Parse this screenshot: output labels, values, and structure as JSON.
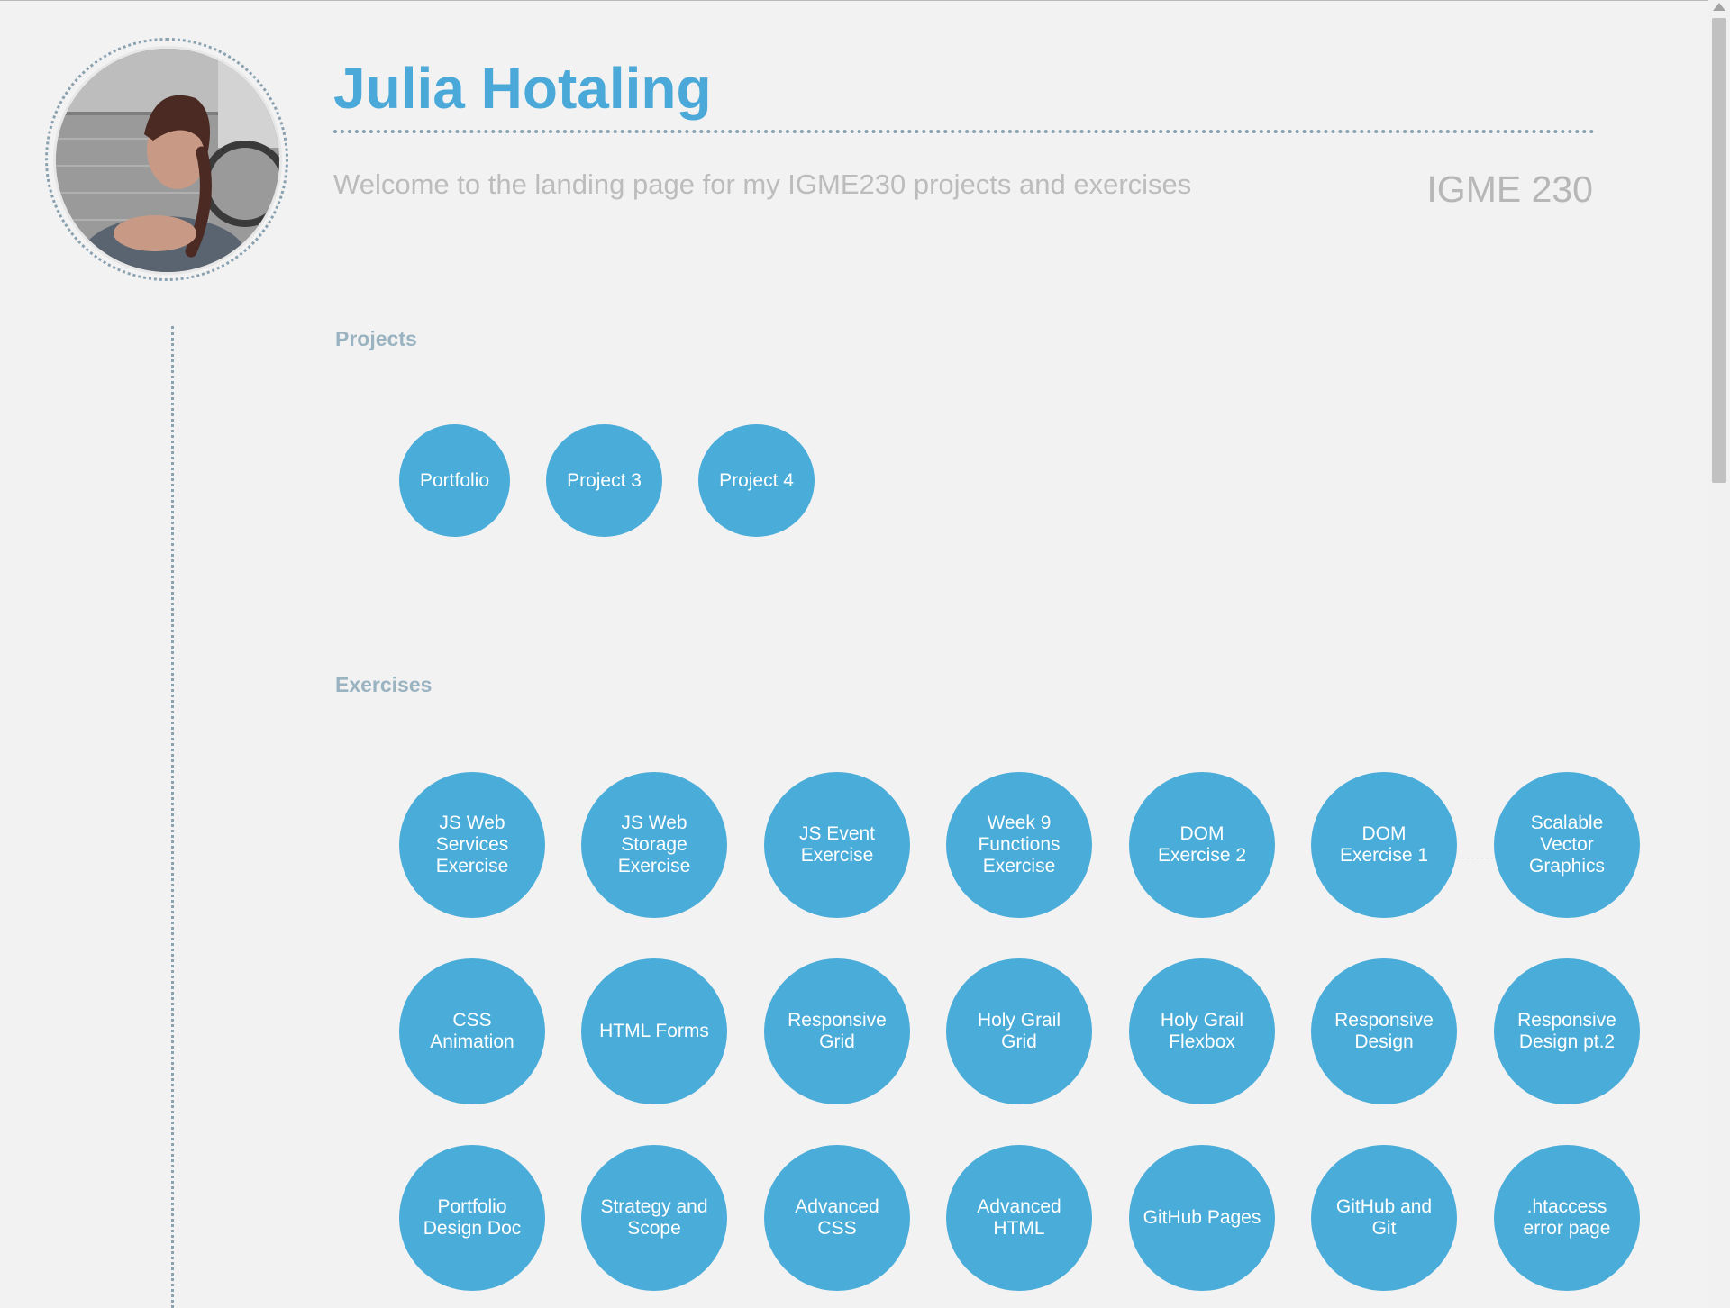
{
  "header": {
    "name": "Julia Hotaling",
    "subtitle": "Welcome to the landing page for my IGME230 projects and exercises",
    "course": "IGME 230"
  },
  "profile": {
    "avatar_icon": "profile-photo"
  },
  "projects": {
    "heading": "Projects",
    "items": [
      {
        "label": "Portfolio"
      },
      {
        "label": "Project 3"
      },
      {
        "label": "Project 4"
      }
    ]
  },
  "exercises": {
    "heading": "Exercises",
    "items": [
      {
        "label": "JS Web Services Exercise"
      },
      {
        "label": "JS Web Storage Exercise"
      },
      {
        "label": "JS Event Exercise"
      },
      {
        "label": "Week 9 Functions Exercise"
      },
      {
        "label": "DOM Exercise 2"
      },
      {
        "label": "DOM Exercise 1"
      },
      {
        "label": "Scalable Vector Graphics"
      },
      {
        "label": "CSS Animation"
      },
      {
        "label": "HTML Forms"
      },
      {
        "label": "Responsive Grid"
      },
      {
        "label": "Holy Grail Grid"
      },
      {
        "label": "Holy Grail Flexbox"
      },
      {
        "label": "Responsive Design"
      },
      {
        "label": "Responsive Design pt.2"
      },
      {
        "label": "Portfolio Design Doc"
      },
      {
        "label": "Strategy and Scope"
      },
      {
        "label": "Advanced CSS"
      },
      {
        "label": "Advanced HTML"
      },
      {
        "label": "GitHub Pages"
      },
      {
        "label": "GitHub and Git"
      },
      {
        "label": ".htaccess error page"
      }
    ]
  },
  "colors": {
    "accent": "#4aacd9",
    "title": "#4aa9d8",
    "muted": "#bcbcbc",
    "section": "#9ab3c1",
    "background": "#f2f2f2"
  }
}
